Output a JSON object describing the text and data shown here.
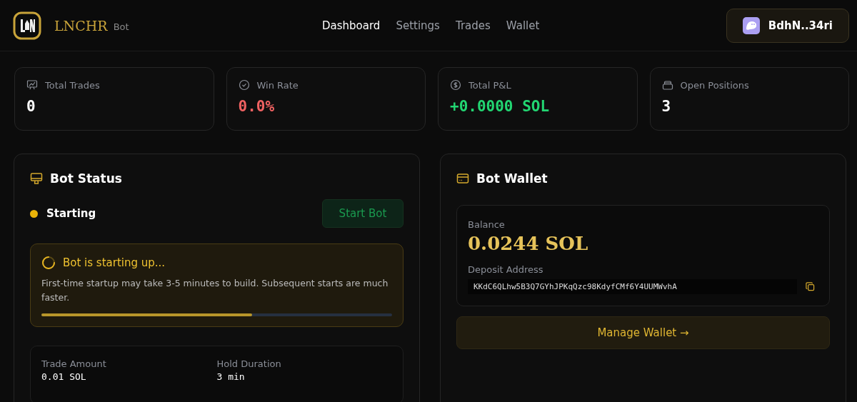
{
  "brand": {
    "name": "LNCHR",
    "tag": "Bot"
  },
  "nav": [
    {
      "label": "Dashboard",
      "selected": true
    },
    {
      "label": "Settings",
      "selected": false
    },
    {
      "label": "Trades",
      "selected": false
    },
    {
      "label": "Wallet",
      "selected": false
    }
  ],
  "account": {
    "label": "BdhN..34ri"
  },
  "stats": [
    {
      "label": "Total Trades",
      "value": "0",
      "kind": "neutral"
    },
    {
      "label": "Win Rate",
      "value": "0.0%",
      "kind": "loss"
    },
    {
      "label": "Total P&L",
      "value": "+0.0000 SOL",
      "kind": "gain"
    },
    {
      "label": "Open Positions",
      "value": "3",
      "kind": "neutral"
    }
  ],
  "bot_status": {
    "title": "Bot Status",
    "status": "Starting",
    "color": "#eab308",
    "start_button": {
      "label": "Start Bot",
      "disabled": true
    },
    "notice": {
      "title": "Bot is starting up...",
      "text": "First-time startup may take 3-5 minutes to build. Subsequent starts are much faster.",
      "level": 0.6
    },
    "config": [
      {
        "label": "Trade Amount",
        "value": "0.01 SOL"
      },
      {
        "label": "Hold Duration",
        "value": "3 min"
      }
    ]
  },
  "bot_wallet": {
    "title": "Bot Wallet",
    "balance_label": "Balance",
    "balance": "0.0244 SOL",
    "address_label": "Deposit Address",
    "address": "KKdC6QLhw5B3Q7GYhJPKqQzc98KdyfCMf6Y4UUMWvhA",
    "manage_button": "Manage Wallet →"
  }
}
